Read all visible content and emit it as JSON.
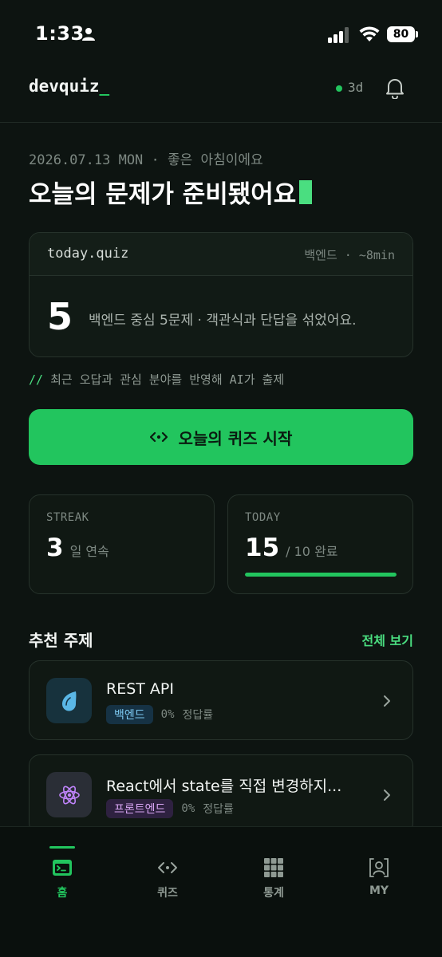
{
  "status_bar": {
    "time": "1:33",
    "battery": "80"
  },
  "header": {
    "logo": "devquiz",
    "logo_cursor": "_",
    "streak_badge": "3d"
  },
  "greeting": {
    "date_line": "2026.07.13 MON · 좋은 아침이에요",
    "headline": "오늘의 문제가 준비됐어요"
  },
  "quiz_card": {
    "file_name": "today.quiz",
    "meta": "백엔드 · ~8min",
    "count": "5",
    "description": "백엔드 중심 5문제 · 객관식과 단답을 섞었어요."
  },
  "comment": {
    "prefix": "//",
    "text": "최근 오답과 관심 분야를 반영해 AI가 출제"
  },
  "start_button": {
    "label": "오늘의 퀴즈 시작"
  },
  "stats": {
    "streak": {
      "label": "STREAK",
      "value": "3",
      "unit": "일 연속"
    },
    "today": {
      "label": "TODAY",
      "value": "15",
      "unit": "/ 10 완료",
      "progress": 1.0
    }
  },
  "recommended": {
    "title": "추천 주제",
    "see_all": "전체 보기",
    "items": [
      {
        "title": "REST API",
        "tag": "백엔드",
        "rate": "0%",
        "rate_label": "정답률",
        "icon": "droplet-icon"
      },
      {
        "title": "React에서 state를 직접 변경하지...",
        "tag": "프론트엔드",
        "rate": "0%",
        "rate_label": "정답률",
        "icon": "react-atom-icon"
      }
    ]
  },
  "bottom_nav": {
    "items": [
      {
        "label": "홈",
        "icon": "terminal-icon",
        "active": true
      },
      {
        "label": "퀴즈",
        "icon": "code-icon",
        "active": false
      },
      {
        "label": "통계",
        "icon": "grid-icon",
        "active": false
      },
      {
        "label": "MY",
        "icon": "user-frame-icon",
        "active": false
      }
    ]
  },
  "colors": {
    "background": "#0d1411",
    "accent": "#22c55e",
    "accent_light": "#4ade80",
    "card": "#101813"
  }
}
